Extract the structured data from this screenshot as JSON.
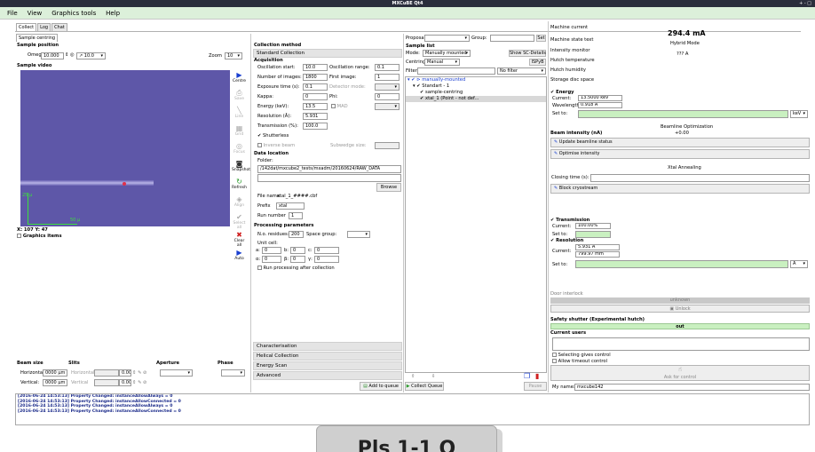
{
  "window": {
    "title": "MXCuBE Qt4",
    "controls": "+ - □"
  },
  "menu": [
    "File",
    "View",
    "Graphics tools",
    "Help"
  ],
  "tabs": [
    "Collect",
    "Log",
    "Chat"
  ],
  "sample_centring_tab": "Sample centring",
  "sample_position": {
    "title": "Sample position",
    "omega_label": "Omega:",
    "omega_value": "10.000",
    "omega_step": "10.0",
    "zoom_label": "Zoom",
    "zoom_value": "10"
  },
  "sample_video": {
    "title": "Sample video",
    "scale_v": "25 μ",
    "scale_h": "50 μ",
    "coords": "X: 107  Y: 47",
    "graphics_items": "Graphics items"
  },
  "toolbar": [
    "Centre",
    "Save",
    "Line",
    "Grid",
    "Focus",
    "Snapshot",
    "Refresh",
    "Align",
    "Select all",
    "Clear all",
    "Auto"
  ],
  "beam": {
    "beam_size": "Beam size",
    "slits": "Slits",
    "aperture": "Aperture",
    "phase": "Phase",
    "horizontal_label": "Horizontal:",
    "horizontal_value": "0000 μm",
    "horizontal_slit": "Horizontal",
    "vertical_label": "Vertical:",
    "vertical_value": "0000 μm",
    "vertical_slit": "Vertical",
    "slit_h_value": "0.00",
    "slit_v_value": "0.00"
  },
  "collection": {
    "method_title": "Collection method",
    "method_value": "Standard Collection",
    "acquisition": "Acquisition",
    "osc_start_label": "Oscillation start:",
    "osc_start": "10.0",
    "osc_range_label": "Oscillation range:",
    "osc_range": "0.1",
    "num_images_label": "Number of images:",
    "num_images": "1800",
    "first_image_label": "First image:",
    "first_image": "1",
    "exposure_label": "Exposure time (s):",
    "exposure": "0.1",
    "detector_mode_label": "Detector mode:",
    "kappa_label": "Kappa:",
    "kappa": "0",
    "phi_label": "Phi:",
    "phi": "0",
    "energy_label": "Energy (keV):",
    "energy": "13.5",
    "mad_label": "MAD",
    "resolution_label": "Resolution (Å):",
    "resolution": "5.931",
    "transmission_label": "Transmission (%):",
    "transmission": "100.0",
    "shutterless_label": "Shutterless",
    "inverse_beam_label": "Inverse beam",
    "subwedge_label": "Subwedge size:"
  },
  "data_location": {
    "title": "Data location",
    "folder_label": "Folder:",
    "folder": "/142dat/mxcube2_tests/mxadm/20160624/RAW_DATA",
    "browse": "Browse",
    "filename_label": "File name:",
    "filename": "xtal_1_####.cbf",
    "prefix_label": "Prefix",
    "prefix": "xtal",
    "run_label": "Run number",
    "run": "1"
  },
  "processing": {
    "title": "Processing parameters",
    "nres_label": "N.o. residues:",
    "nres": "200",
    "space_group_label": "Space group:",
    "unit_cell_label": "Unit cell:",
    "a_label": "a:",
    "a": "0",
    "b_label": "b:",
    "b": "0",
    "c_label": "c:",
    "c": "0",
    "alpha_label": "α:",
    "alpha": "0",
    "beta_label": "β:",
    "beta": "0",
    "gamma_label": "γ:",
    "gamma": "0",
    "run_processing": "Run processing after collection"
  },
  "method_tabs": [
    "Characterisation",
    "Helical Collection",
    "Energy Scan",
    "Advanced"
  ],
  "add_to_queue": "Add to queue",
  "collect_queue": "Collect Queue",
  "pause": "Pause",
  "proposal": {
    "label": "Proposal:",
    "group_label": "Group:",
    "set": "Set"
  },
  "sample_list": {
    "title": "Sample list",
    "mode_label": "Mode:",
    "mode_value": "Manually mounted",
    "show_sc": "Show SC-Details",
    "centring_label": "Centring:",
    "centring_value": "Manual",
    "ispyb": "ISPyB",
    "filter_label": "Filter:",
    "no_filter": "No filter",
    "tree": [
      "manually-mounted",
      "Standart - 1",
      "sample-centring",
      "xtal_1 (Point - not def..."
    ]
  },
  "right": {
    "machine_current_label": "Machine current",
    "machine_current": "294.4 mA",
    "state_label": "Machine state text",
    "state_value": "Hybrid Mode",
    "intensity_label": "Intensity monitor",
    "intensity_value": "??? A",
    "hutch_temp": "Hutch temperature",
    "hutch_humidity": "Hutch humidity",
    "storage_disc": "Storage disc space",
    "energy_title": "Energy",
    "current_label": "Current:",
    "energy_current": "13.5000 keV",
    "wavelength_label": "Wavelength:",
    "wavelength": "0.918 Å",
    "set_to": "Set to:",
    "energy_unit": "keV",
    "beamline_opt": "Beamline Optimization",
    "beam_intensity_label": "Beam intensity (nA)",
    "beam_intensity": "+0.00",
    "update_beamline": "Update beamline status",
    "optimise_intensity": "Optimise intensity",
    "xtal_annealing": "Xtal Annealing",
    "closing_time": "Closing time (s):",
    "block_cryo": "Block cryostream",
    "transmission_title": "Transmission",
    "transmission_current": "100.00%",
    "resolution_title": "Resolution",
    "resolution_current": "5.931 Å",
    "resolution_mm": "799.97 mm",
    "res_unit": "Å",
    "door_interlock": "Door interlock",
    "door_state": "unknown",
    "unlock": "Unlock",
    "safety_shutter": "Safety shutter (Experimental hutch)",
    "shutter_state": "out",
    "current_users": "Current users",
    "selecting_control": "Selecting gives control",
    "allow_timeout": "Allow timeout control",
    "ask_control": "Ask for control",
    "my_name_label": "My name:",
    "my_name": "mxcube142"
  },
  "log": [
    "[2016-06-24 14:53:13] Property Changed: instanceAllowAlways = 0",
    "[2016-06-24 14:53:13] Property Changed: instanceAllowConnected = 0",
    "[2016-06-24 14:53:13] Property Changed: instanceAllowAlways = 0",
    "[2016-06-24 14:53:13] Property Changed: instanceAllowConnected = 0"
  ],
  "overlay_text": "Pls 1-1 Q"
}
